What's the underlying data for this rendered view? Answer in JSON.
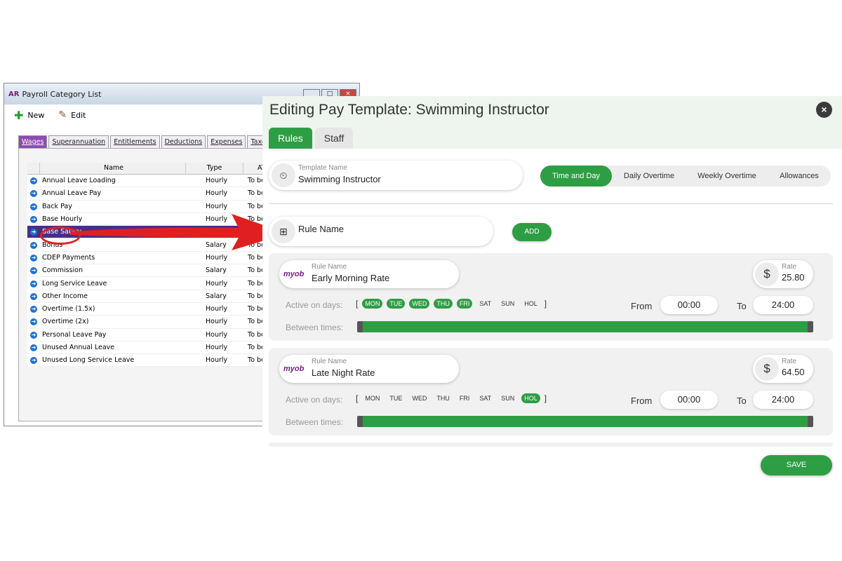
{
  "legacy_window": {
    "title": "Payroll Category List",
    "app_logo": "AR",
    "toolbar": {
      "new_label": "New",
      "edit_label": "Edit"
    },
    "tabs": [
      {
        "label": "Wages",
        "active": true
      },
      {
        "label": "Superannuation"
      },
      {
        "label": "Entitlements"
      },
      {
        "label": "Deductions"
      },
      {
        "label": "Expenses"
      },
      {
        "label": "Taxes"
      }
    ],
    "columns": {
      "name": "Name",
      "type": "Type",
      "ato": "ATO"
    },
    "rows": [
      {
        "name": "Annual Leave Loading",
        "type": "Hourly",
        "ato": "To be a"
      },
      {
        "name": "Annual Leave Pay",
        "type": "Hourly",
        "ato": "To be a"
      },
      {
        "name": "Back Pay",
        "type": "Hourly",
        "ato": "To be a"
      },
      {
        "name": "Base Hourly",
        "type": "Hourly",
        "ato": "To be a"
      },
      {
        "name": "Base Salary",
        "type": "",
        "ato": "",
        "selected": true
      },
      {
        "name": "Bonus",
        "type": "Salary",
        "ato": "To be a"
      },
      {
        "name": "CDEP Payments",
        "type": "Hourly",
        "ato": "To be a"
      },
      {
        "name": "Commission",
        "type": "Salary",
        "ato": "To be a"
      },
      {
        "name": "Long Service Leave",
        "type": "Hourly",
        "ato": "To be a"
      },
      {
        "name": "Other Income",
        "type": "Salary",
        "ato": "To be a"
      },
      {
        "name": "Overtime (1.5x)",
        "type": "Hourly",
        "ato": "To be a"
      },
      {
        "name": "Overtime (2x)",
        "type": "Hourly",
        "ato": "To be a"
      },
      {
        "name": "Personal Leave Pay",
        "type": "Hourly",
        "ato": "To be a"
      },
      {
        "name": "Unused Annual Leave",
        "type": "Hourly",
        "ato": "To be a"
      },
      {
        "name": "Unused Long Service Leave",
        "type": "Hourly",
        "ato": "To be a"
      }
    ]
  },
  "template": {
    "title": "Editing Pay Template: Swimming Instructor",
    "tabs": [
      {
        "label": "Rules",
        "active": true
      },
      {
        "label": "Staff"
      }
    ],
    "template_name_label": "Template Name",
    "template_name_value": "Swimming Instructor",
    "segments": [
      {
        "label": "Time and Day",
        "active": true
      },
      {
        "label": "Daily Overtime"
      },
      {
        "label": "Weekly Overtime"
      },
      {
        "label": "Allowances"
      }
    ],
    "rule_name_placeholder": "Rule Name",
    "add_label": "ADD",
    "rules": [
      {
        "logo": "myob",
        "name_label": "Rule Name",
        "name": "Early Morning Rate",
        "rate_label": "Rate",
        "rate": "25.80",
        "active_days_label": "Active on days:",
        "bracket_open": "[",
        "bracket_close": "]",
        "days": [
          {
            "label": "MON",
            "on": true
          },
          {
            "label": "TUE",
            "on": true
          },
          {
            "label": "WED",
            "on": true
          },
          {
            "label": "THU",
            "on": true
          },
          {
            "label": "FRI",
            "on": true
          },
          {
            "label": "SAT",
            "on": false
          },
          {
            "label": "SUN",
            "on": false
          },
          {
            "label": "HOL",
            "on": false
          }
        ],
        "from_label": "From",
        "from": "00:00",
        "to_label": "To",
        "to": "24:00",
        "between_label": "Between times:"
      },
      {
        "logo": "myob",
        "name_label": "Rule Name",
        "name": "Late Night Rate",
        "rate_label": "Rate",
        "rate": "64.50",
        "active_days_label": "Active on days:",
        "bracket_open": "[",
        "bracket_close": "]",
        "days": [
          {
            "label": "MON",
            "on": false
          },
          {
            "label": "TUE",
            "on": false
          },
          {
            "label": "WED",
            "on": false
          },
          {
            "label": "THU",
            "on": false
          },
          {
            "label": "FRI",
            "on": false
          },
          {
            "label": "SAT",
            "on": false
          },
          {
            "label": "SUN",
            "on": false
          },
          {
            "label": "HOL",
            "on": true
          }
        ],
        "from_label": "From",
        "from": "00:00",
        "to_label": "To",
        "to": "24:00",
        "between_label": "Between times:"
      }
    ],
    "save_label": "SAVE",
    "close_icon": "×",
    "currency_symbol": "$"
  },
  "colors": {
    "accent": "#2e9e44",
    "legacy_selection": "#4a2d8a",
    "arrow": "#e02020",
    "myob": "#7a1c8a"
  }
}
